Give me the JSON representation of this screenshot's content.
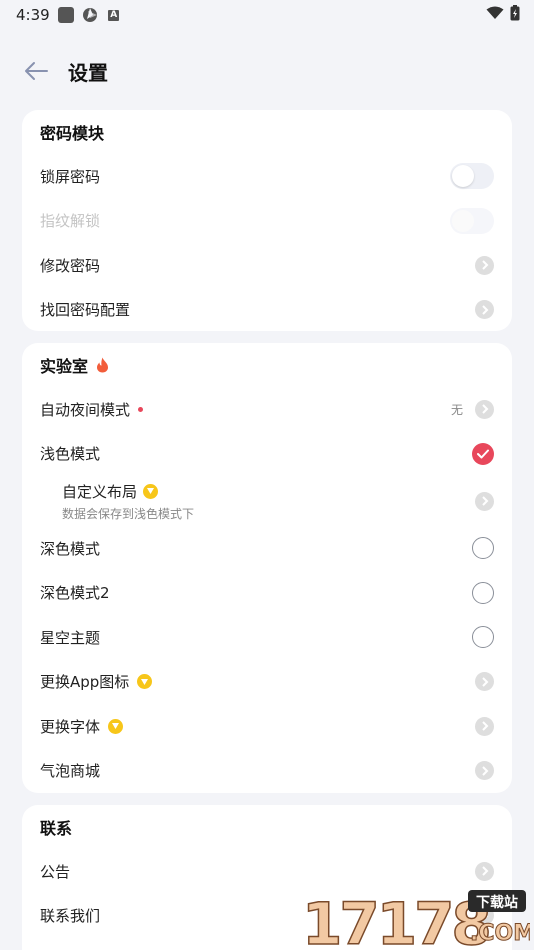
{
  "status_bar": {
    "time": "4:39"
  },
  "header": {
    "title": "设置"
  },
  "password_section": {
    "title": "密码模块",
    "items": [
      {
        "label": "锁屏密码"
      },
      {
        "label": "指纹解锁"
      },
      {
        "label": "修改密码"
      },
      {
        "label": "找回密码配置"
      }
    ]
  },
  "lab_section": {
    "title": "实验室",
    "items": [
      {
        "label": "自动夜间模式",
        "value": "无"
      },
      {
        "label": "浅色模式"
      },
      {
        "label": "自定义布局",
        "desc": "数据会保存到浅色模式下"
      },
      {
        "label": "深色模式"
      },
      {
        "label": "深色模式2"
      },
      {
        "label": "星空主题"
      },
      {
        "label": "更换App图标"
      },
      {
        "label": "更换字体"
      },
      {
        "label": "气泡商城"
      }
    ]
  },
  "contact_section": {
    "title": "联系",
    "items": [
      {
        "label": "公告"
      },
      {
        "label": "联系我们"
      }
    ]
  },
  "watermark": {
    "text": "17178",
    "badge": "下载站",
    "domain": ".COM"
  },
  "colors": {
    "accent": "#e8475b",
    "vip": "#f7c61a",
    "background": "#f3f4f8"
  }
}
